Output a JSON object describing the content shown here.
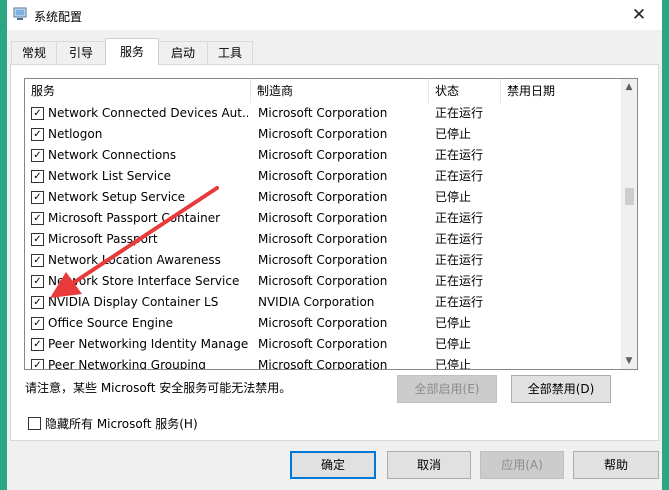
{
  "window": {
    "title": "系统配置",
    "close_glyph": "✕"
  },
  "tabs": [
    {
      "label": "常规"
    },
    {
      "label": "引导"
    },
    {
      "label": "服务"
    },
    {
      "label": "启动"
    },
    {
      "label": "工具"
    }
  ],
  "active_tab": "服务",
  "table": {
    "columns": [
      "服务",
      "制造商",
      "状态",
      "禁用日期"
    ],
    "rows": [
      {
        "name": "Network Connected Devices Aut...",
        "vendor": "Microsoft Corporation",
        "status": "正在运行",
        "date": "",
        "checked": true
      },
      {
        "name": "Netlogon",
        "vendor": "Microsoft Corporation",
        "status": "已停止",
        "date": "",
        "checked": true
      },
      {
        "name": "Network Connections",
        "vendor": "Microsoft Corporation",
        "status": "正在运行",
        "date": "",
        "checked": true
      },
      {
        "name": "Network List Service",
        "vendor": "Microsoft Corporation",
        "status": "正在运行",
        "date": "",
        "checked": true
      },
      {
        "name": "Network Setup Service",
        "vendor": "Microsoft Corporation",
        "status": "已停止",
        "date": "",
        "checked": true
      },
      {
        "name": "Microsoft Passport Container",
        "vendor": "Microsoft Corporation",
        "status": "正在运行",
        "date": "",
        "checked": true
      },
      {
        "name": "Microsoft Passport",
        "vendor": "Microsoft Corporation",
        "status": "正在运行",
        "date": "",
        "checked": true
      },
      {
        "name": "Network Location Awareness",
        "vendor": "Microsoft Corporation",
        "status": "正在运行",
        "date": "",
        "checked": true
      },
      {
        "name": "Network Store Interface Service",
        "vendor": "Microsoft Corporation",
        "status": "正在运行",
        "date": "",
        "checked": true
      },
      {
        "name": "NVIDIA Display Container LS",
        "vendor": "NVIDIA Corporation",
        "status": "正在运行",
        "date": "",
        "checked": true
      },
      {
        "name": "Office  Source Engine",
        "vendor": "Microsoft Corporation",
        "status": "已停止",
        "date": "",
        "checked": true
      },
      {
        "name": "Peer Networking Identity Manager",
        "vendor": "Microsoft Corporation",
        "status": "已停止",
        "date": "",
        "checked": true
      },
      {
        "name": "Peer Networking Grouping",
        "vendor": "Microsoft Corporation",
        "status": "已停止",
        "date": "",
        "checked": true
      }
    ]
  },
  "note": "请注意，某些 Microsoft 安全服务可能无法禁用。",
  "buttons": {
    "enable_all": "全部启用(E)",
    "disable_all": "全部禁用(D)",
    "ok": "确定",
    "cancel": "取消",
    "apply": "应用(A)",
    "help": "帮助"
  },
  "hide_ms": {
    "label": "隐藏所有 Microsoft 服务(H)",
    "checked": false
  },
  "colors": {
    "accent": "#0078d7",
    "arrow": "#e83a3a",
    "frame": "#2aa682"
  }
}
